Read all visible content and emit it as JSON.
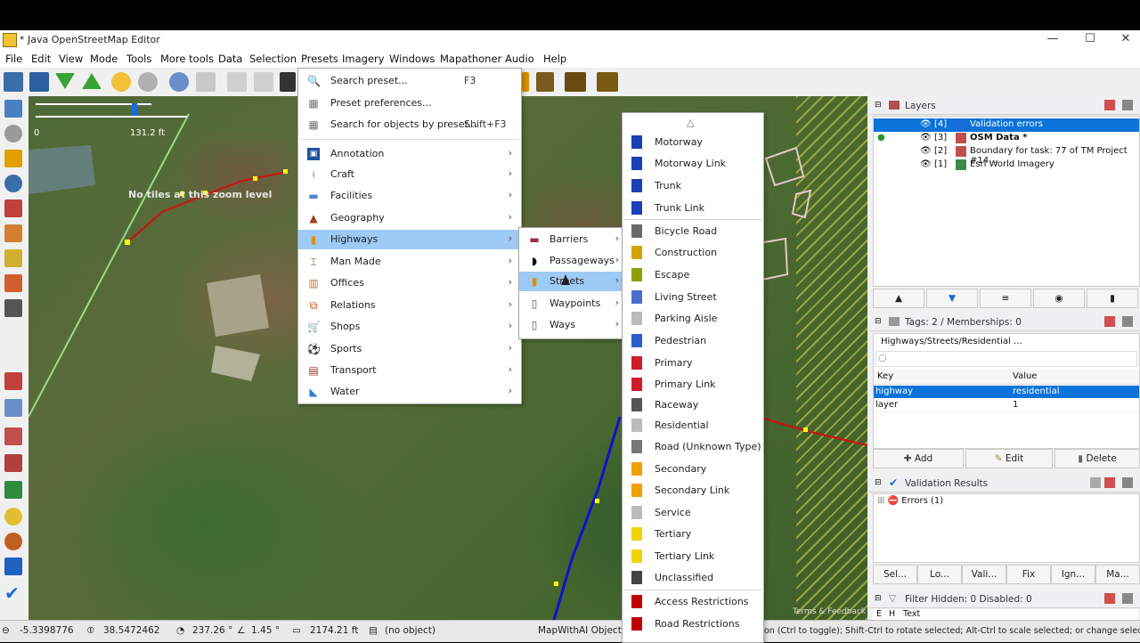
{
  "window": {
    "title": "* Java OpenStreetMap Editor",
    "minimize": "—",
    "maximize": "☐",
    "close": "✕"
  },
  "menubar": [
    "File",
    "Edit",
    "View",
    "Mode",
    "Tools",
    "More tools",
    "Data",
    "Selection",
    "Presets",
    "Imagery",
    "Windows",
    "Mapathoner",
    "Audio",
    "Help"
  ],
  "map": {
    "no_tiles_text": "No tiles at this zoom level",
    "scale_left": "0",
    "scale_right": "131.2 ft",
    "attribution": "Terms & Feedback"
  },
  "presets_menu": {
    "top_items": [
      {
        "label": "Search preset...",
        "shortcut": "F3",
        "icon": "search-icon"
      },
      {
        "label": "Preset preferences...",
        "shortcut": "",
        "icon": "preferences-icon"
      },
      {
        "label": "Search for objects by preset...",
        "shortcut": "Shift+F3",
        "icon": "search-objects-icon"
      }
    ],
    "groups": [
      {
        "label": "Annotation",
        "icon": "annotation-icon"
      },
      {
        "label": "Craft",
        "icon": "craft-icon"
      },
      {
        "label": "Facilities",
        "icon": "facilities-icon"
      },
      {
        "label": "Geography",
        "icon": "geography-icon"
      },
      {
        "label": "Highways",
        "icon": "highways-icon",
        "highlighted": true
      },
      {
        "label": "Man Made",
        "icon": "man-made-icon"
      },
      {
        "label": "Offices",
        "icon": "offices-icon"
      },
      {
        "label": "Relations",
        "icon": "relations-icon"
      },
      {
        "label": "Shops",
        "icon": "shops-icon"
      },
      {
        "label": "Sports",
        "icon": "sports-icon"
      },
      {
        "label": "Transport",
        "icon": "transport-icon"
      },
      {
        "label": "Water",
        "icon": "water-icon"
      }
    ]
  },
  "highways_menu": [
    {
      "label": "Barriers",
      "icon": "barriers-icon"
    },
    {
      "label": "Passageways",
      "icon": "passageways-icon"
    },
    {
      "label": "Streets",
      "icon": "streets-icon",
      "highlighted": true
    },
    {
      "label": "Waypoints",
      "icon": "waypoints-icon"
    },
    {
      "label": "Ways",
      "icon": "ways-icon"
    }
  ],
  "streets_menu": {
    "scroll_up": "△",
    "items": [
      {
        "label": "Motorway",
        "color": "#1a3fb8"
      },
      {
        "label": "Motorway Link",
        "color": "#1a3fb8"
      },
      {
        "label": "Trunk",
        "color": "#1a3fb8"
      },
      {
        "label": "Trunk Link",
        "color": "#1a3fb8"
      },
      {
        "label": "Bicycle Road",
        "color": "#6a6a6a",
        "sep_before": true
      },
      {
        "label": "Construction",
        "color": "#d4a300"
      },
      {
        "label": "Escape",
        "color": "#8aa000"
      },
      {
        "label": "Living Street",
        "color": "#4a6fd0"
      },
      {
        "label": "Parking Aisle",
        "color": "#bbbbbb"
      },
      {
        "label": "Pedestrian",
        "color": "#2a60c8"
      },
      {
        "label": "Primary",
        "color": "#d01c2a"
      },
      {
        "label": "Primary Link",
        "color": "#d01c2a"
      },
      {
        "label": "Raceway",
        "color": "#555555"
      },
      {
        "label": "Residential",
        "color": "#bbbbbb"
      },
      {
        "label": "Road (Unknown Type)",
        "color": "#777777"
      },
      {
        "label": "Secondary",
        "color": "#f0a000"
      },
      {
        "label": "Secondary Link",
        "color": "#f0a000"
      },
      {
        "label": "Service",
        "color": "#bbbbbb"
      },
      {
        "label": "Tertiary",
        "color": "#f2d200"
      },
      {
        "label": "Tertiary Link",
        "color": "#f2d200"
      },
      {
        "label": "Unclassified",
        "color": "#444444"
      },
      {
        "label": "Access Restrictions",
        "color": "#c00000",
        "sep_before": true
      },
      {
        "label": "Road Restrictions",
        "color": "#c00000"
      }
    ]
  },
  "layers_panel": {
    "title": "Layers",
    "rows": [
      {
        "num": "[4]",
        "name": "Validation errors",
        "selected": true
      },
      {
        "num": "[3]",
        "name": "OSM Data *",
        "bold": true
      },
      {
        "num": "[2]",
        "name": "Boundary for task: 77 of TM Project #14..."
      },
      {
        "num": "[1]",
        "name": "Esri World Imagery"
      }
    ]
  },
  "tags_panel": {
    "title": "Tags: 2 / Memberships: 0",
    "preset_path": "Highways/Streets/Residential ...",
    "col_key": "Key",
    "col_value": "Value",
    "rows": [
      {
        "key": "highway",
        "value": "residential",
        "selected": true
      },
      {
        "key": "layer",
        "value": "1"
      }
    ],
    "add": "Add",
    "edit": "Edit",
    "delete": "Delete"
  },
  "validation_panel": {
    "title": "Validation Results",
    "errors": "Errors (1)",
    "buttons": [
      "Sel...",
      "Lo...",
      "Vali...",
      "Fix",
      "Ign...",
      "Ma..."
    ]
  },
  "filter_panel": {
    "title": "Filter Hidden: 0 Disabled: 0",
    "cols": [
      "E",
      "H",
      "Text"
    ]
  },
  "statusbar": {
    "lat": "-5.3398776",
    "lon": "38.5472462",
    "heading": "237.26 °",
    "angle": "1.45 °",
    "distance": "2174.21 ft",
    "object": "(no object)",
    "plugin": "MapWithAI Objects",
    "help": "on (Ctrl to toggle); Shift-Ctrl to rotate selected; Alt-Ctrl to scale selected; or change selection"
  }
}
